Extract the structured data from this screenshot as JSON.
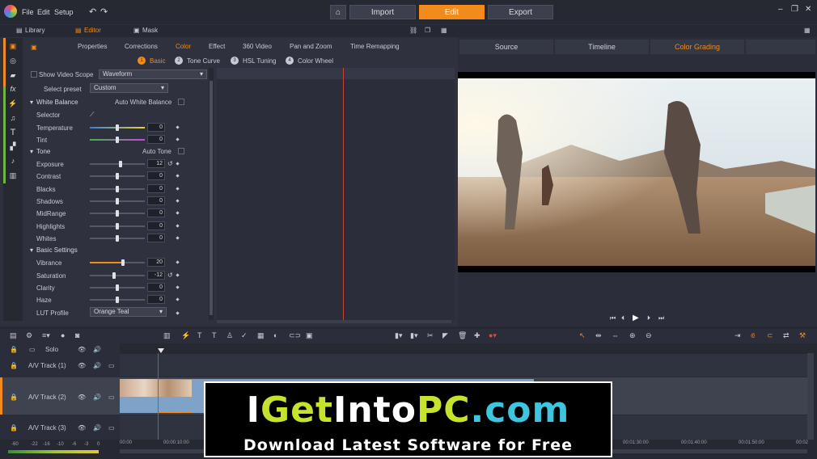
{
  "topbar": {
    "menu": [
      "File",
      "Edit",
      "Setup"
    ],
    "home_icon": "home-icon",
    "tabs": [
      {
        "label": "Import",
        "active": false
      },
      {
        "label": "Edit",
        "active": true
      },
      {
        "label": "Export",
        "active": false
      }
    ],
    "window_controls": [
      "–",
      "❐",
      "✕"
    ]
  },
  "panel_tabs": [
    {
      "label": "Library",
      "active": false
    },
    {
      "label": "Editor",
      "active": true
    },
    {
      "label": "Mask",
      "active": false
    }
  ],
  "editor_tabs": [
    {
      "label": "Properties",
      "active": false
    },
    {
      "label": "Corrections",
      "active": false
    },
    {
      "label": "Color",
      "active": true
    },
    {
      "label": "Effect",
      "active": false
    },
    {
      "label": "360 Video",
      "active": false
    },
    {
      "label": "Pan and Zoom",
      "active": false
    },
    {
      "label": "Time Remapping",
      "active": false
    }
  ],
  "color_subtabs": [
    {
      "num": "1",
      "label": "Basic",
      "active": true
    },
    {
      "num": "2",
      "label": "Tone Curve",
      "active": false
    },
    {
      "num": "3",
      "label": "HSL Tuning",
      "active": false
    },
    {
      "num": "4",
      "label": "Color Wheel",
      "active": false
    }
  ],
  "video_scope": {
    "label": "Show Video Scope",
    "value": "Waveform"
  },
  "preset": {
    "label": "Select preset",
    "value": "Custom"
  },
  "white_balance": {
    "title": "White Balance",
    "auto_label": "Auto White Balance",
    "selector_label": "Selector"
  },
  "wb_rows": [
    {
      "label": "Temperature",
      "value": "0",
      "pos": 0.5,
      "kind": "temp"
    },
    {
      "label": "Tint",
      "value": "0",
      "pos": 0.5,
      "kind": "tint"
    }
  ],
  "tone": {
    "title": "Tone",
    "auto_label": "Auto Tone"
  },
  "tone_rows": [
    {
      "label": "Exposure",
      "value": "12",
      "pos": 0.56,
      "reset": true
    },
    {
      "label": "Contrast",
      "value": "0",
      "pos": 0.5
    },
    {
      "label": "Blacks",
      "value": "0",
      "pos": 0.5
    },
    {
      "label": "Shadows",
      "value": "0",
      "pos": 0.5
    },
    {
      "label": "MidRange",
      "value": "0",
      "pos": 0.5
    },
    {
      "label": "Highlights",
      "value": "0",
      "pos": 0.5
    },
    {
      "label": "Whites",
      "value": "0",
      "pos": 0.5
    }
  ],
  "basic_settings": {
    "title": "Basic Settings"
  },
  "basic_rows": [
    {
      "label": "Vibrance",
      "value": "20",
      "pos": 0.6,
      "accent": true
    },
    {
      "label": "Saturation",
      "value": "-12",
      "pos": 0.44,
      "reset": true
    },
    {
      "label": "Clarity",
      "value": "0",
      "pos": 0.5
    },
    {
      "label": "Haze",
      "value": "0",
      "pos": 0.5
    }
  ],
  "lut": {
    "label": "LUT Profile",
    "value": "Orange Teal"
  },
  "right_tabs": [
    {
      "label": "Source",
      "active": false
    },
    {
      "label": "Timeline",
      "active": false
    },
    {
      "label": "Color Grading",
      "active": true
    }
  ],
  "tracks": [
    {
      "name": "Solo"
    },
    {
      "name": "A/V Track (1)"
    },
    {
      "name": "A/V Track (2)"
    },
    {
      "name": "A/V Track (3)"
    }
  ],
  "ruler": [
    "00:00",
    "00:00:10:00",
    "00:01:30:00",
    "00:01:40:00",
    "00:01:50:00",
    "00:02"
  ],
  "meter_labels": [
    "-60",
    "-22",
    "-16",
    "-10",
    "-6",
    "-3",
    "0"
  ],
  "banner": {
    "brand_white1": "I",
    "brand_yellow1": "Get",
    "brand_white2": "Into",
    "brand_yellow2": "PC",
    "brand_cyan": ".com",
    "tagline": "Download Latest Software for Free"
  },
  "colors": {
    "accent": "#f28b1c",
    "brand_yellow": "#c6e22a",
    "brand_cyan": "#3ec6e0"
  }
}
